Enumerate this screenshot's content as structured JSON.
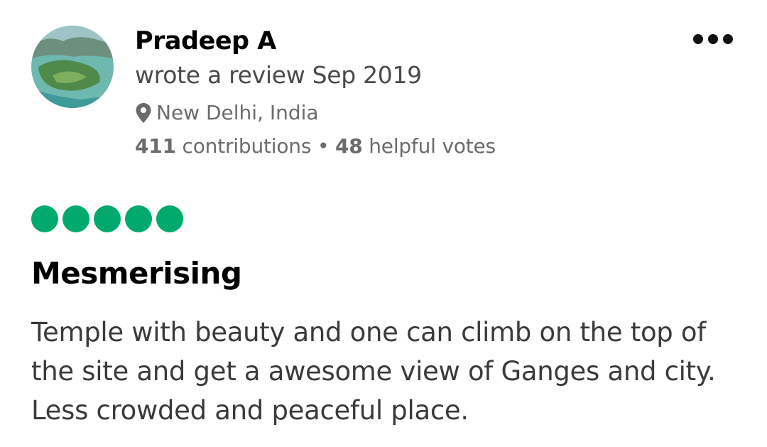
{
  "reviewer": {
    "name": "Pradeep A",
    "wrote_text": "wrote a review Sep 2019",
    "location": "New Delhi, India",
    "contributions_count": "411",
    "contributions_label": " contributions",
    "separator": " • ",
    "helpful_count": "48",
    "helpful_label": " helpful votes"
  },
  "icons": {
    "avatar": "profile-photo-island",
    "location": "map-pin-icon",
    "menu": "more-options-icon"
  },
  "review": {
    "rating": 5,
    "rating_max": 5,
    "rating_color": "#00aa6c",
    "title": "Mesmerising",
    "text": "Temple with beauty and one can climb on the top of the site and get a awesome view of Ganges and city. Less crowded and peaceful place."
  }
}
